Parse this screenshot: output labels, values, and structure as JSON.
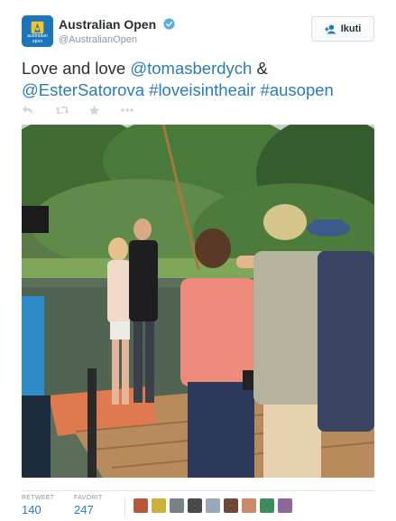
{
  "account": {
    "display_name": "Australian Open",
    "handle": "@AustralianOpen",
    "avatar_text": "australian open",
    "avatar_color": "#1b75bb",
    "verified_color": "#55acee"
  },
  "follow_button": {
    "label": "Ikuti"
  },
  "tweet": {
    "line1_plain": "Love and love ",
    "mention1": "@tomasberdych",
    "line1_tail": " &",
    "mention2": "@EsterSatorova",
    "space1": " ",
    "hashtag1": "#loveisintheair",
    "space2": " ",
    "hashtag2": "#ausopen"
  },
  "actions": [
    "reply-icon",
    "retweet-icon",
    "favorite-icon",
    "more-icon"
  ],
  "stats": {
    "retweet_label": "RETWEET",
    "retweet_count": "140",
    "favorite_label": "FAVORIT",
    "favorite_count": "247"
  },
  "favoriter_avatar_colors": [
    "#b5583a",
    "#c9b23a",
    "#7b7f86",
    "#4a4a4a",
    "#9aa7b4",
    "#6b4a3a",
    "#c98c6a",
    "#3f8a5a",
    "#8b6a9a"
  ],
  "colors": {
    "link": "#2b7bb9",
    "text": "#292f33",
    "muted": "#8899a6"
  }
}
